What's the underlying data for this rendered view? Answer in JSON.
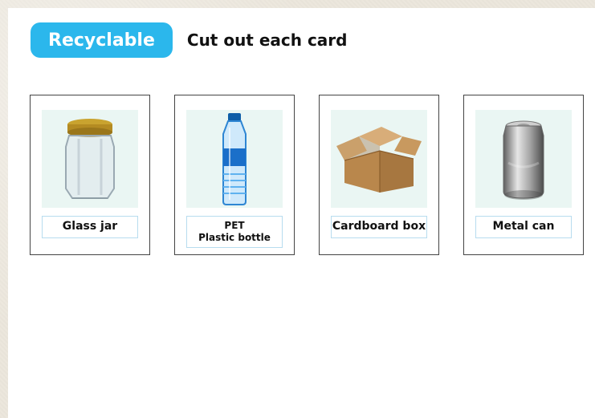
{
  "header": {
    "badge_label": "Recyclable",
    "subtitle": "Cut out each card"
  },
  "cards": [
    {
      "id": "glass-jar",
      "label_line1": "Glass jar",
      "label_line2": ""
    },
    {
      "id": "pet-bottle",
      "label_line1": "PET",
      "label_line2": "Plastic bottle"
    },
    {
      "id": "cardboard-box",
      "label_line1": "Cardboard box",
      "label_line2": ""
    },
    {
      "id": "metal-can",
      "label_line1": "Metal can",
      "label_line2": ""
    }
  ],
  "colors": {
    "badge_bg": "#2bb7ec",
    "card_image_bg": "#eaf6f3",
    "label_border": "#b7dcef"
  },
  "icons": [
    "glass-jar-icon",
    "plastic-bottle-icon",
    "cardboard-box-icon",
    "metal-can-icon"
  ]
}
